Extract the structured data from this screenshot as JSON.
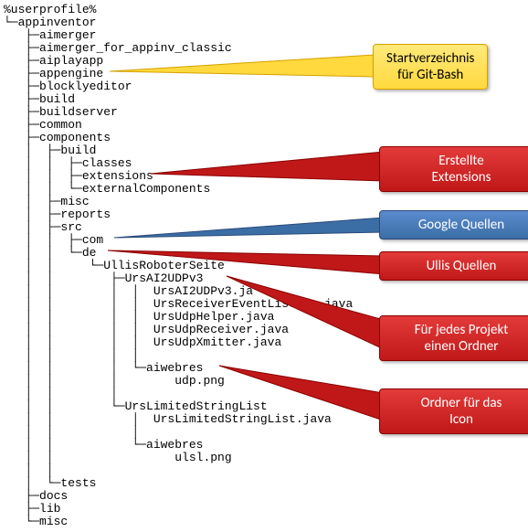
{
  "tree": {
    "root": "%userprofile%",
    "n0": "appinventor",
    "n1": "aimerger",
    "n2": "aimerger_for_appinv_classic",
    "n3": "aiplayapp",
    "n4": "appengine",
    "n5": "blocklyeditor",
    "n6": "build",
    "n7": "buildserver",
    "n8": "common",
    "n9": "components",
    "n9a": "build",
    "n9a1": "classes",
    "n9a2": "extensions",
    "n9a3": "externalComponents",
    "n9b": "misc",
    "n9c": "reports",
    "n9d": "src",
    "n9d1": "com",
    "n9d2": "de",
    "n9d2a": "UllisRoboterSeite",
    "n9d2a1": "UrsAI2UDPv3",
    "f1": "UrsAI2UDPv3.ja",
    "f2": "UrsReceiverEventListe...java",
    "f3": "UrsUdpHelper.java",
    "f4": "UrsUdpReceiver.java",
    "f5": "UrsUdpXmitter.java",
    "n9d2a1r": "aiwebres",
    "f6": "udp.png",
    "n9d2a2": "UrsLimitedStringList",
    "f7": "UrsLimitedStringList.java",
    "n9d2a2r": "aiwebres",
    "f8": "ulsl.png",
    "n9e": "tests",
    "n10": "docs",
    "n11": "lib",
    "n12": "misc"
  },
  "callouts": {
    "c1_l1": "Startverzeichnis",
    "c1_l2": "für  Git-Bash",
    "c2_l1": "Erstellte",
    "c2_l2": "Extensions",
    "c3": "Google Quellen",
    "c4": "Ullis Quellen",
    "c5_l1": "Für jedes Projekt",
    "c5_l2": "einen Ordner",
    "c6_l1": "Ordner  für das",
    "c6_l2": "Icon"
  }
}
